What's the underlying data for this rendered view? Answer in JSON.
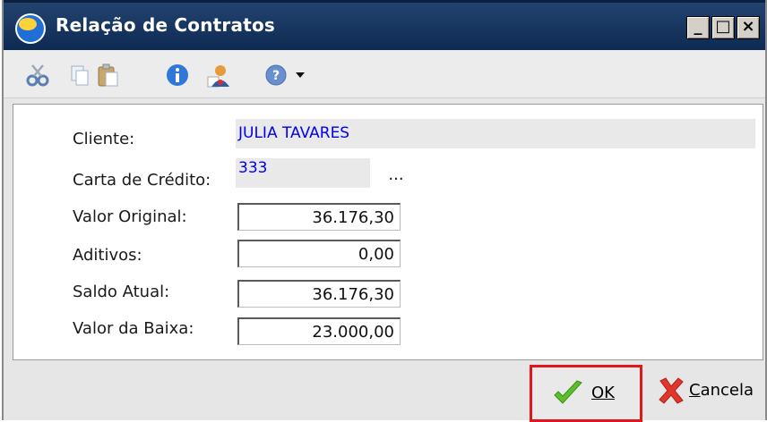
{
  "window": {
    "title": "Relação de Contratos",
    "controls": {
      "minimize": "_",
      "maximize": "□",
      "close": "×"
    }
  },
  "toolbar": {
    "icons": [
      "cut-icon",
      "copy-icon",
      "paste-icon",
      "info-icon",
      "user-icon",
      "help-icon",
      "dropdown-arrow-icon"
    ]
  },
  "form": {
    "cliente": {
      "label": "Cliente:",
      "value": "JULIA TAVARES"
    },
    "carta_credito": {
      "label": "Carta de Crédito:",
      "value": "333",
      "lookup_label": "..."
    },
    "valor_original": {
      "label": "Valor Original:",
      "value": "36.176,30"
    },
    "aditivos": {
      "label": "Aditivos:",
      "value": "0,00"
    },
    "saldo_atual": {
      "label": "Saldo Atual:",
      "value": "36.176,30"
    },
    "valor_baixa": {
      "label": "Valor da Baixa:",
      "value": "23.000,00"
    }
  },
  "buttons": {
    "ok_label": "OK",
    "cancel_label_first": "C",
    "cancel_label_rest": "ancela"
  },
  "colors": {
    "titlebar": "#0d2a52",
    "value_text": "#0000ee",
    "highlight": "#e0161b"
  }
}
